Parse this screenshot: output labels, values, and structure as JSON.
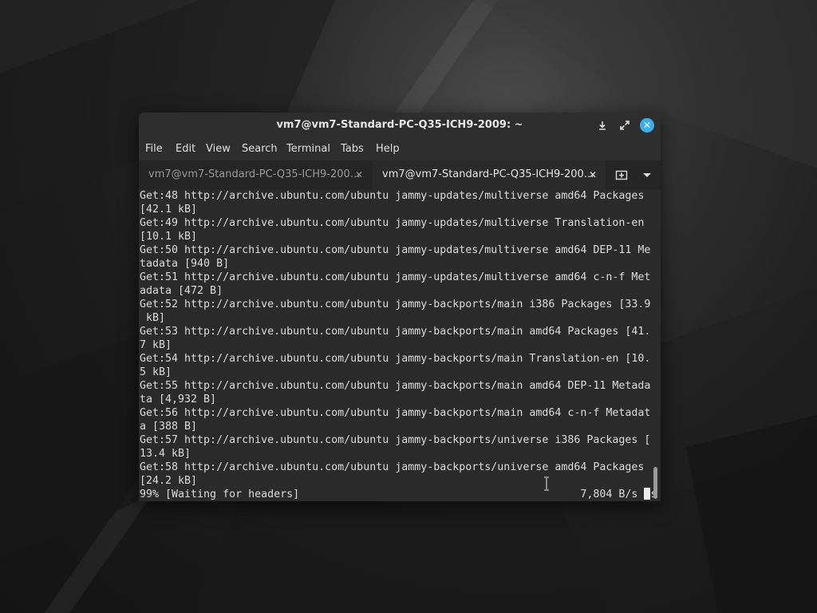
{
  "window": {
    "title": "vm7@vm7-Standard-PC-Q35-ICH9-2009: ~",
    "buttons": [
      "minimize-icon",
      "maximize-icon",
      "close-icon"
    ]
  },
  "menu": [
    "File",
    "Edit",
    "View",
    "Search",
    "Terminal",
    "Tabs",
    "Help"
  ],
  "tabs": [
    {
      "label": "vm7@vm7-Standard-PC-Q35-ICH9-200…",
      "active": false
    },
    {
      "label": "vm7@vm7-Standard-PC-Q35-ICH9-200…",
      "active": true
    }
  ],
  "terminal": {
    "lines": [
      "Get:48 http://archive.ubuntu.com/ubuntu jammy-updates/multiverse amd64 Packages",
      "[42.1 kB]",
      "Get:49 http://archive.ubuntu.com/ubuntu jammy-updates/multiverse Translation-en",
      "[10.1 kB]",
      "Get:50 http://archive.ubuntu.com/ubuntu jammy-updates/multiverse amd64 DEP-11 Me",
      "tadata [940 B]",
      "Get:51 http://archive.ubuntu.com/ubuntu jammy-updates/multiverse amd64 c-n-f Met",
      "adata [472 B]",
      "Get:52 http://archive.ubuntu.com/ubuntu jammy-backports/main i386 Packages [33.9",
      " kB]",
      "Get:53 http://archive.ubuntu.com/ubuntu jammy-backports/main amd64 Packages [41.",
      "7 kB]",
      "Get:54 http://archive.ubuntu.com/ubuntu jammy-backports/main Translation-en [10.",
      "5 kB]",
      "Get:55 http://archive.ubuntu.com/ubuntu jammy-backports/main amd64 DEP-11 Metada",
      "ta [4,932 B]",
      "Get:56 http://archive.ubuntu.com/ubuntu jammy-backports/main amd64 c-n-f Metadat",
      "a [388 B]",
      "Get:57 http://archive.ubuntu.com/ubuntu jammy-backports/universe i386 Packages [",
      "13.4 kB]",
      "Get:58 http://archive.ubuntu.com/ubuntu jammy-backports/universe amd64 Packages",
      "[24.2 kB]",
      "99% [Waiting for headers]                                            7,804 B/s 4s"
    ]
  },
  "colors": {
    "terminal_bg": "#2b2b2b",
    "terminal_fg": "#dddddd",
    "close_button": "#3daee9"
  }
}
